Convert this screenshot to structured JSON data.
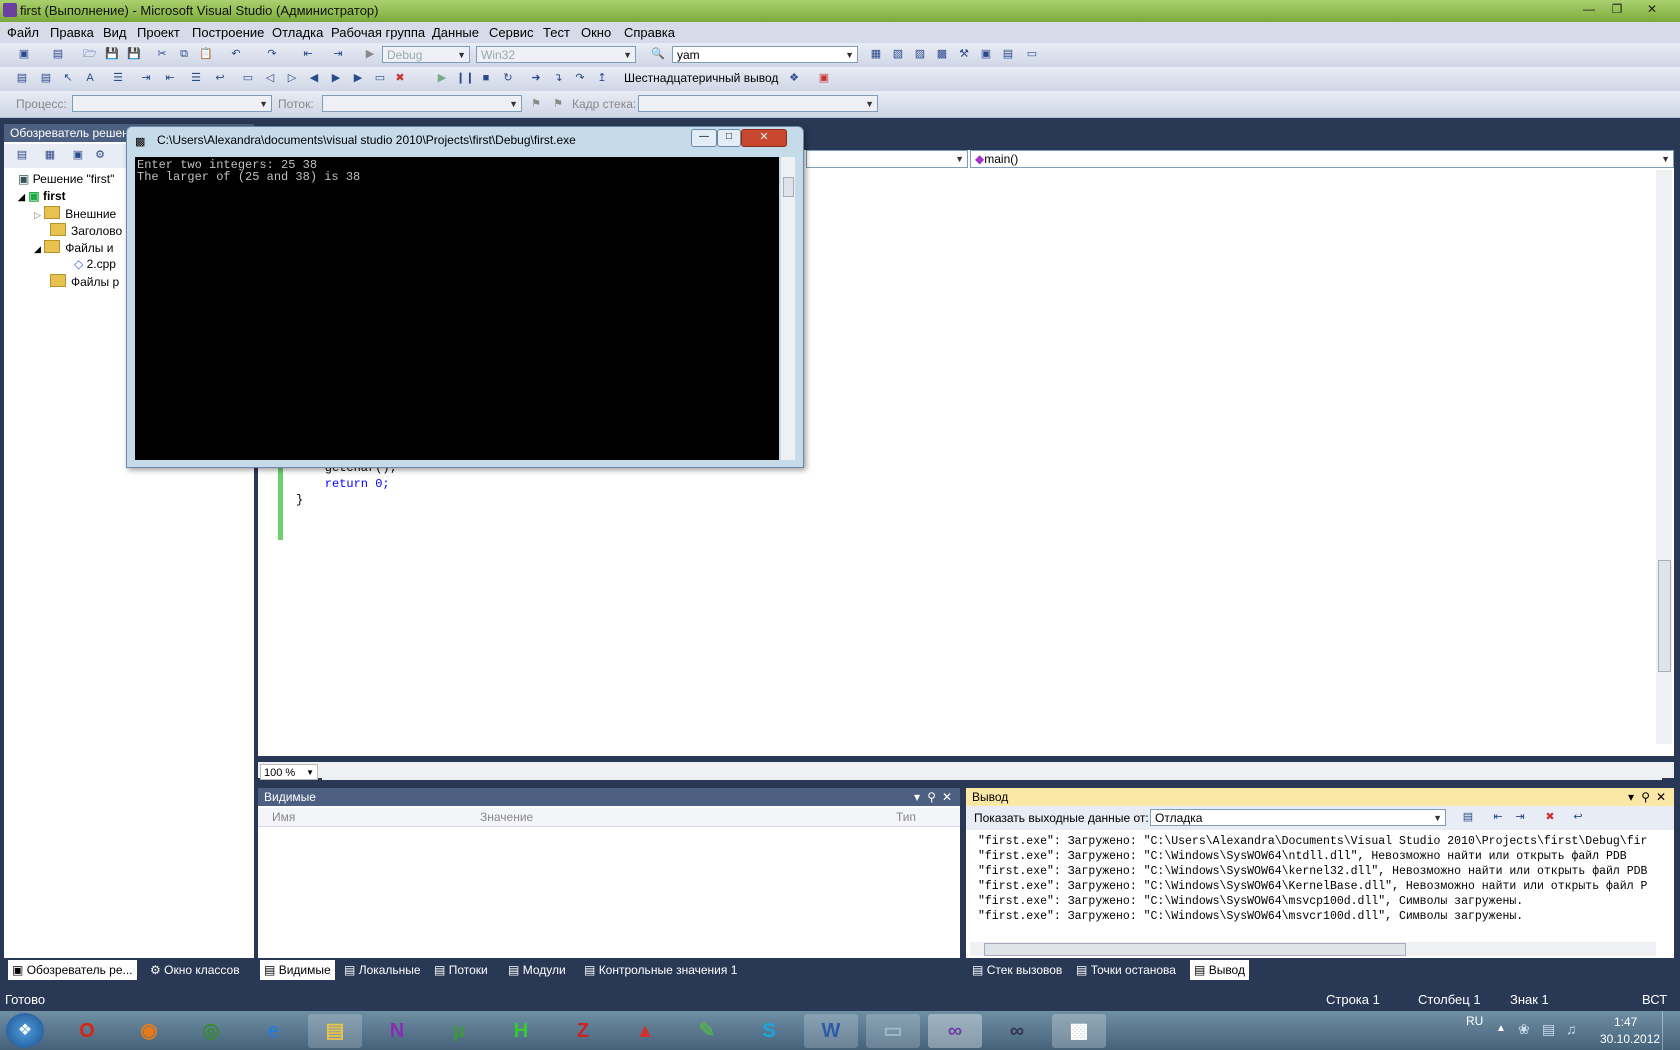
{
  "window": {
    "title": "first (Выполнение) - Microsoft Visual Studio (Администратор)"
  },
  "menu": [
    "Файл",
    "Правка",
    "Вид",
    "Проект",
    "Построение",
    "Отладка",
    "Рабочая группа",
    "Данные",
    "Сервис",
    "Тест",
    "Окно",
    "Справка"
  ],
  "toolbar": {
    "config": "Debug",
    "platform": "Win32",
    "find": "yam",
    "hex_label": "Шестнадцатеричный вывод"
  },
  "debugbar": {
    "process_label": "Процесс:",
    "thread_label": "Поток:",
    "stackframe_label": "Кадр стека:"
  },
  "solution_explorer": {
    "title": "Обозреватель решен",
    "items": [
      "Решение \"first\"",
      "first",
      "Внешние",
      "Заголово",
      "Файлы и",
      "2.cpp",
      "Файлы р"
    ]
  },
  "console": {
    "title": "C:\\Users\\Alexandra\\documents\\visual studio 2010\\Projects\\first\\Debug\\first.exe",
    "lines": [
      "Enter two integers: 25 38",
      "The larger of (25 and 38) is 38"
    ]
  },
  "editor": {
    "member_combo": "main()",
    "zoom": "100 %",
    "code": [
      "    getchar();",
      "    return 0;",
      "}"
    ]
  },
  "locals_panel": {
    "title": "Видимые",
    "columns": [
      "Имя",
      "Значение",
      "Тип"
    ]
  },
  "output_panel": {
    "title": "Вывод",
    "show_from_label": "Показать выходные данные от:",
    "source": "Отладка",
    "lines": [
      "\"first.exe\": Загружено: \"C:\\Users\\Alexandra\\Documents\\Visual Studio 2010\\Projects\\first\\Debug\\fir",
      "\"first.exe\": Загружено: \"C:\\Windows\\SysWOW64\\ntdll.dll\", Невозможно найти или открыть файл PDB",
      "\"first.exe\": Загружено: \"C:\\Windows\\SysWOW64\\kernel32.dll\", Невозможно найти или открыть файл PDB",
      "\"first.exe\": Загружено: \"C:\\Windows\\SysWOW64\\KernelBase.dll\", Невозможно найти или открыть файл P",
      "\"first.exe\": Загружено: \"C:\\Windows\\SysWOW64\\msvcp100d.dll\", Символы загружены.",
      "\"first.exe\": Загружено: \"C:\\Windows\\SysWOW64\\msvcr100d.dll\", Символы загружены."
    ]
  },
  "bottom_tabs_left": [
    "Обозреватель ре...",
    "Окно классов"
  ],
  "bottom_tabs_mid": [
    "Видимые",
    "Локальные",
    "Потоки",
    "Модули",
    "Контрольные значения 1"
  ],
  "bottom_tabs_right": [
    "Стек вызовов",
    "Точки останова",
    "Вывод"
  ],
  "status": {
    "ready": "Готово",
    "line": "Строка 1",
    "col": "Столбец 1",
    "ch": "Знак 1",
    "mode": "ВСТ"
  },
  "taskbar": {
    "lang": "RU",
    "time": "1:47",
    "date": "30.10.2012"
  }
}
